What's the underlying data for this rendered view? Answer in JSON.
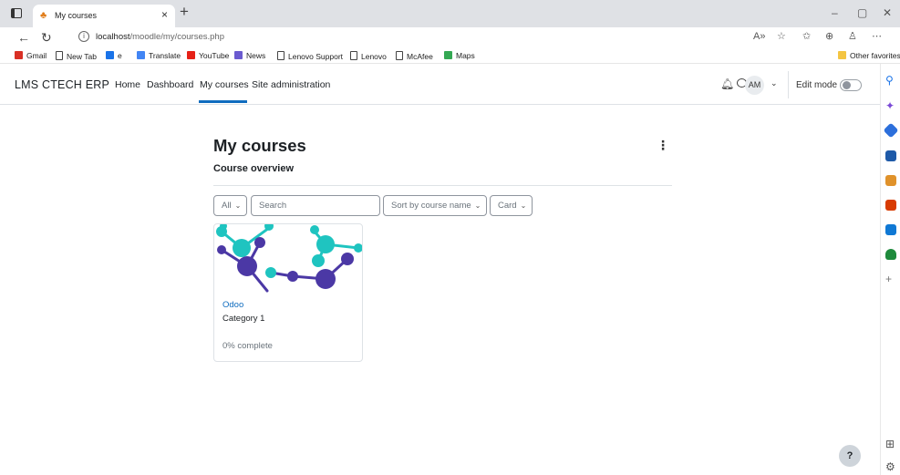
{
  "browser": {
    "tab_title": "My courses",
    "tab_close": "×",
    "new_tab": "+",
    "url_host": "localhost",
    "url_path": "/moodle/my/courses.php",
    "window_controls": [
      "–",
      "▢",
      "✕"
    ],
    "favorites": [
      {
        "label": "Gmail",
        "icon": "gmail-icon",
        "color": "#d93025"
      },
      {
        "label": "New Tab",
        "icon": "page-icon"
      },
      {
        "label": "e",
        "icon": "drive-icon",
        "color": "#1a73e8"
      },
      {
        "label": "Translate",
        "icon": "translate-icon",
        "color": "#4285f4"
      },
      {
        "label": "YouTube",
        "icon": "youtube-icon",
        "color": "#e62117"
      },
      {
        "label": "News",
        "icon": "news-icon",
        "color": "#6b5bd0"
      },
      {
        "label": "Lenovo Support",
        "icon": "page-icon"
      },
      {
        "label": "Lenovo",
        "icon": "page-icon"
      },
      {
        "label": "McAfee",
        "icon": "page-icon"
      },
      {
        "label": "Maps",
        "icon": "maps-icon",
        "color": "#34a853"
      }
    ],
    "other_favorites": "Other favorites"
  },
  "navbar": {
    "brand": "LMS CTECH ERP",
    "links": [
      "Home",
      "Dashboard",
      "My courses",
      "Site administration"
    ],
    "active_link": "My courses",
    "avatar_initials": "AM",
    "edit_mode_label": "Edit mode",
    "edit_mode_on": false
  },
  "page": {
    "title": "My courses",
    "section_title": "Course overview",
    "filters": {
      "grouping": "All",
      "search_placeholder": "Search",
      "sort": "Sort by course name",
      "view": "Card"
    },
    "courses": [
      {
        "name": "Odoo",
        "category": "Category 1",
        "progress_text": "0% complete",
        "progress": 0
      }
    ],
    "help_label": "?"
  },
  "colors": {
    "accent": "#0f6cbf",
    "molecule_teal": "#1fc4c0",
    "molecule_purple": "#4b38a5"
  }
}
